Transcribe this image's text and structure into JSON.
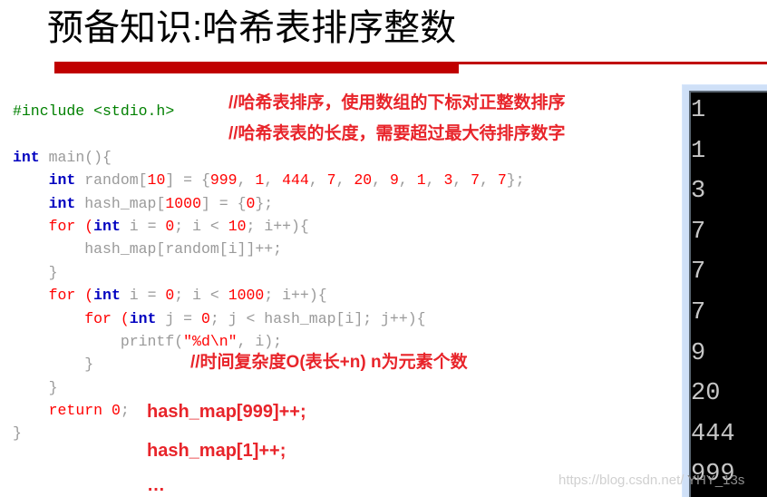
{
  "slide": {
    "title": "预备知识:哈希表排序整数",
    "accent_color": "#c00000",
    "annotation_color": "#e8242a"
  },
  "code": {
    "language": "c",
    "lines": [
      {
        "indent": 0,
        "tokens": [
          {
            "t": "#include <stdio.h>",
            "c": "pre"
          }
        ]
      },
      {
        "indent": 0,
        "tokens": [
          {
            "t": "",
            "c": "blank"
          }
        ]
      },
      {
        "indent": 0,
        "tokens": [
          {
            "t": "int",
            "c": "kw"
          },
          {
            "t": " main(){",
            "c": "id"
          }
        ]
      },
      {
        "indent": 1,
        "tokens": [
          {
            "t": "int",
            "c": "kw"
          },
          {
            "t": " random[",
            "c": "id"
          },
          {
            "t": "10",
            "c": "num"
          },
          {
            "t": "] = {",
            "c": "id"
          },
          {
            "t": "999",
            "c": "num"
          },
          {
            "t": ", ",
            "c": "id"
          },
          {
            "t": "1",
            "c": "num"
          },
          {
            "t": ", ",
            "c": "id"
          },
          {
            "t": "444",
            "c": "num"
          },
          {
            "t": ", ",
            "c": "id"
          },
          {
            "t": "7",
            "c": "num"
          },
          {
            "t": ", ",
            "c": "id"
          },
          {
            "t": "20",
            "c": "num"
          },
          {
            "t": ", ",
            "c": "id"
          },
          {
            "t": "9",
            "c": "num"
          },
          {
            "t": ", ",
            "c": "id"
          },
          {
            "t": "1",
            "c": "num"
          },
          {
            "t": ", ",
            "c": "id"
          },
          {
            "t": "3",
            "c": "num"
          },
          {
            "t": ", ",
            "c": "id"
          },
          {
            "t": "7",
            "c": "num"
          },
          {
            "t": ", ",
            "c": "id"
          },
          {
            "t": "7",
            "c": "num"
          },
          {
            "t": "};",
            "c": "id"
          }
        ]
      },
      {
        "indent": 1,
        "tokens": [
          {
            "t": "int",
            "c": "kw"
          },
          {
            "t": " hash_map[",
            "c": "id"
          },
          {
            "t": "1000",
            "c": "num"
          },
          {
            "t": "] = {",
            "c": "id"
          },
          {
            "t": "0",
            "c": "num"
          },
          {
            "t": "};",
            "c": "id"
          }
        ]
      },
      {
        "indent": 1,
        "tokens": [
          {
            "t": "for",
            "c": "kw2"
          },
          {
            "t": " (",
            "c": "kw2"
          },
          {
            "t": "int",
            "c": "kw"
          },
          {
            "t": " i = ",
            "c": "id"
          },
          {
            "t": "0",
            "c": "num"
          },
          {
            "t": "; i < ",
            "c": "id"
          },
          {
            "t": "10",
            "c": "num"
          },
          {
            "t": "; i++){",
            "c": "id"
          }
        ]
      },
      {
        "indent": 2,
        "tokens": [
          {
            "t": "hash_map[random[i]]++;",
            "c": "id"
          }
        ]
      },
      {
        "indent": 1,
        "tokens": [
          {
            "t": "}",
            "c": "id"
          }
        ]
      },
      {
        "indent": 1,
        "tokens": [
          {
            "t": "for",
            "c": "kw2"
          },
          {
            "t": " (",
            "c": "kw2"
          },
          {
            "t": "int",
            "c": "kw"
          },
          {
            "t": " i = ",
            "c": "id"
          },
          {
            "t": "0",
            "c": "num"
          },
          {
            "t": "; i < ",
            "c": "id"
          },
          {
            "t": "1000",
            "c": "num"
          },
          {
            "t": "; i++){",
            "c": "id"
          }
        ]
      },
      {
        "indent": 2,
        "tokens": [
          {
            "t": "for",
            "c": "kw2"
          },
          {
            "t": " (",
            "c": "kw2"
          },
          {
            "t": "int",
            "c": "kw"
          },
          {
            "t": " j = ",
            "c": "id"
          },
          {
            "t": "0",
            "c": "num"
          },
          {
            "t": "; j < hash_map[i]; j++){",
            "c": "id"
          }
        ]
      },
      {
        "indent": 3,
        "tokens": [
          {
            "t": "printf(",
            "c": "id"
          },
          {
            "t": "\"%d\\n\"",
            "c": "str"
          },
          {
            "t": ", i);",
            "c": "id"
          }
        ]
      },
      {
        "indent": 2,
        "tokens": [
          {
            "t": "}",
            "c": "id"
          }
        ]
      },
      {
        "indent": 1,
        "tokens": [
          {
            "t": "}",
            "c": "id"
          }
        ]
      },
      {
        "indent": 1,
        "tokens": [
          {
            "t": "return",
            "c": "kw2"
          },
          {
            "t": " ",
            "c": "id"
          },
          {
            "t": "0",
            "c": "num"
          },
          {
            "t": ";",
            "c": "id"
          }
        ]
      },
      {
        "indent": 0,
        "tokens": [
          {
            "t": "}",
            "c": "id"
          }
        ]
      }
    ]
  },
  "annotations": {
    "comment_1": "//哈希表排序，使用数组的下标对正整数排序",
    "comment_2": "//哈希表表的长度，需要超过最大待排序数字",
    "comment_3": "//时间复杂度O(表长+n) n为元素个数"
  },
  "hash_calls": {
    "line_1": "hash_map[999]++;",
    "line_2": "hash_map[1]++;",
    "line_3": "…"
  },
  "console": {
    "output": [
      "1",
      "1",
      "3",
      "7",
      "7",
      "7",
      "9",
      "20",
      "444",
      "999"
    ]
  },
  "watermark": {
    "prefix": "https://blog.csdn.net/",
    "suffix": "YHY_13s"
  }
}
